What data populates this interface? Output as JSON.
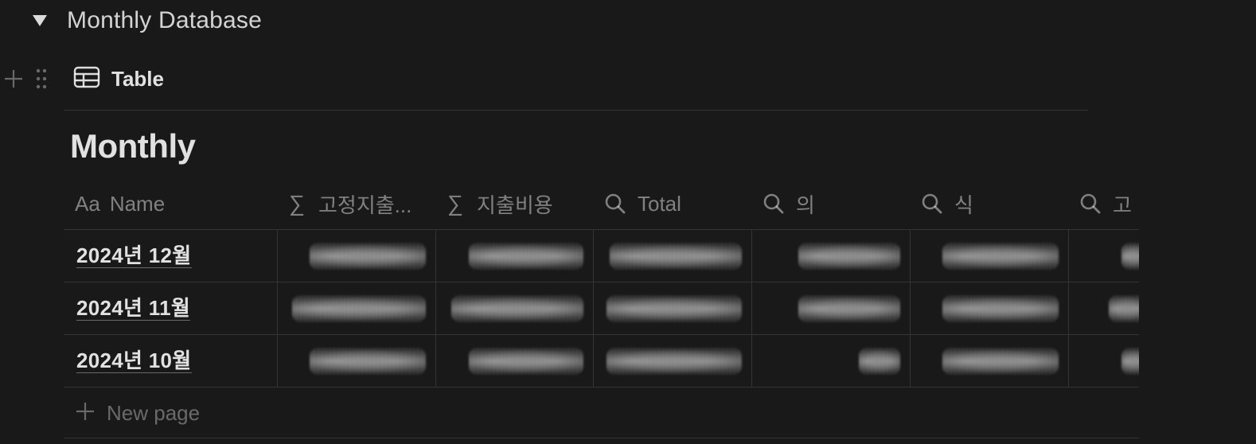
{
  "toggle": {
    "title": "Monthly Database",
    "expanded": true
  },
  "view": {
    "tab_label": "Table",
    "icon": "table-icon"
  },
  "database": {
    "title": "Monthly"
  },
  "table": {
    "columns": [
      {
        "label": "Name",
        "icon": "Aa"
      },
      {
        "label": "고정지출...",
        "icon": "sigma-icon"
      },
      {
        "label": "지출비용",
        "icon": "sigma-icon"
      },
      {
        "label": "Total",
        "icon": "search-icon"
      },
      {
        "label": "의",
        "icon": "search-icon"
      },
      {
        "label": "식",
        "icon": "search-icon"
      },
      {
        "label": "고",
        "icon": "search-icon"
      }
    ],
    "rows": [
      {
        "name": "2024년 12월"
      },
      {
        "name": "2024년 11월"
      },
      {
        "name": "2024년 10월"
      }
    ]
  },
  "new_page_label": "New page"
}
